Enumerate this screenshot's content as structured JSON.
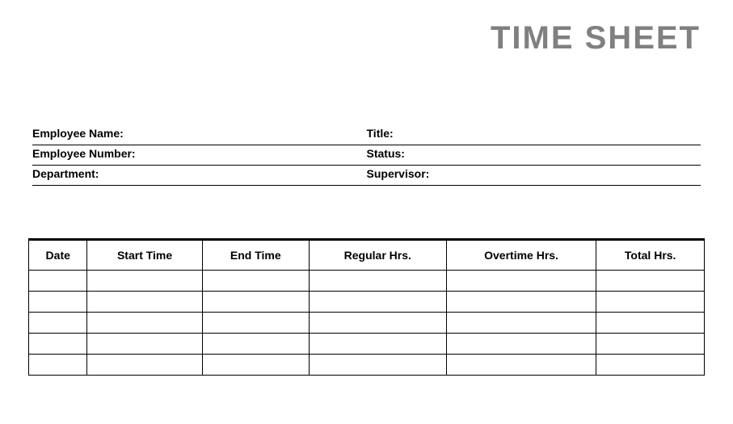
{
  "page": {
    "title": "TIME SHEET"
  },
  "info": {
    "employee_name_label": "Employee Name:",
    "title_label": "Title:",
    "employee_number_label": "Employee Number:",
    "status_label": "Status:",
    "department_label": "Department:",
    "supervisor_label": "Supervisor:"
  },
  "table": {
    "headers": {
      "date": "Date",
      "start_time": "Start Time",
      "end_time": "End Time",
      "regular_hrs": "Regular Hrs.",
      "overtime_hrs": "Overtime Hrs.",
      "total_hrs": "Total Hrs."
    },
    "rows": [
      {
        "date": "",
        "start_time": "",
        "end_time": "",
        "regular_hrs": "",
        "overtime_hrs": "",
        "total_hrs": ""
      },
      {
        "date": "",
        "start_time": "",
        "end_time": "",
        "regular_hrs": "",
        "overtime_hrs": "",
        "total_hrs": ""
      },
      {
        "date": "",
        "start_time": "",
        "end_time": "",
        "regular_hrs": "",
        "overtime_hrs": "",
        "total_hrs": ""
      },
      {
        "date": "",
        "start_time": "",
        "end_time": "",
        "regular_hrs": "",
        "overtime_hrs": "",
        "total_hrs": ""
      },
      {
        "date": "",
        "start_time": "",
        "end_time": "",
        "regular_hrs": "",
        "overtime_hrs": "",
        "total_hrs": ""
      }
    ]
  }
}
